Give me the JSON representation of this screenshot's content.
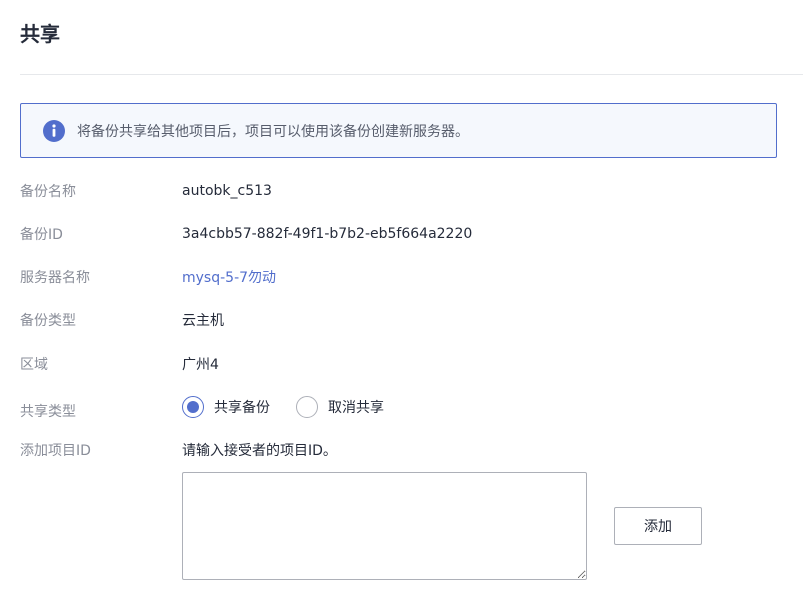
{
  "header": {
    "title": "共享"
  },
  "banner": {
    "icon": "info-icon",
    "text": "将备份共享给其他项目后，项目可以使用该备份创建新服务器。"
  },
  "fields": {
    "backup_name": {
      "label": "备份名称",
      "value": "autobk_c513"
    },
    "backup_id": {
      "label": "备份ID",
      "value": "3a4cbb57-882f-49f1-b7b2-eb5f664a2220"
    },
    "server_name": {
      "label": "服务器名称",
      "value": "mysq-5-7勿动"
    },
    "backup_type": {
      "label": "备份类型",
      "value": "云主机"
    },
    "region": {
      "label": "区域",
      "value": "广州4"
    },
    "share_type": {
      "label": "共享类型",
      "options": [
        {
          "label": "共享备份",
          "selected": true
        },
        {
          "label": "取消共享",
          "selected": false
        }
      ]
    },
    "add_project_id": {
      "label": "添加项目ID",
      "hint": "请输入接受者的项目ID。",
      "input_value": "",
      "button_label": "添加"
    }
  },
  "colors": {
    "accent": "#526ecc",
    "label": "#8a8e99",
    "text": "#252b3a",
    "banner_bg": "#f5f8fd"
  }
}
